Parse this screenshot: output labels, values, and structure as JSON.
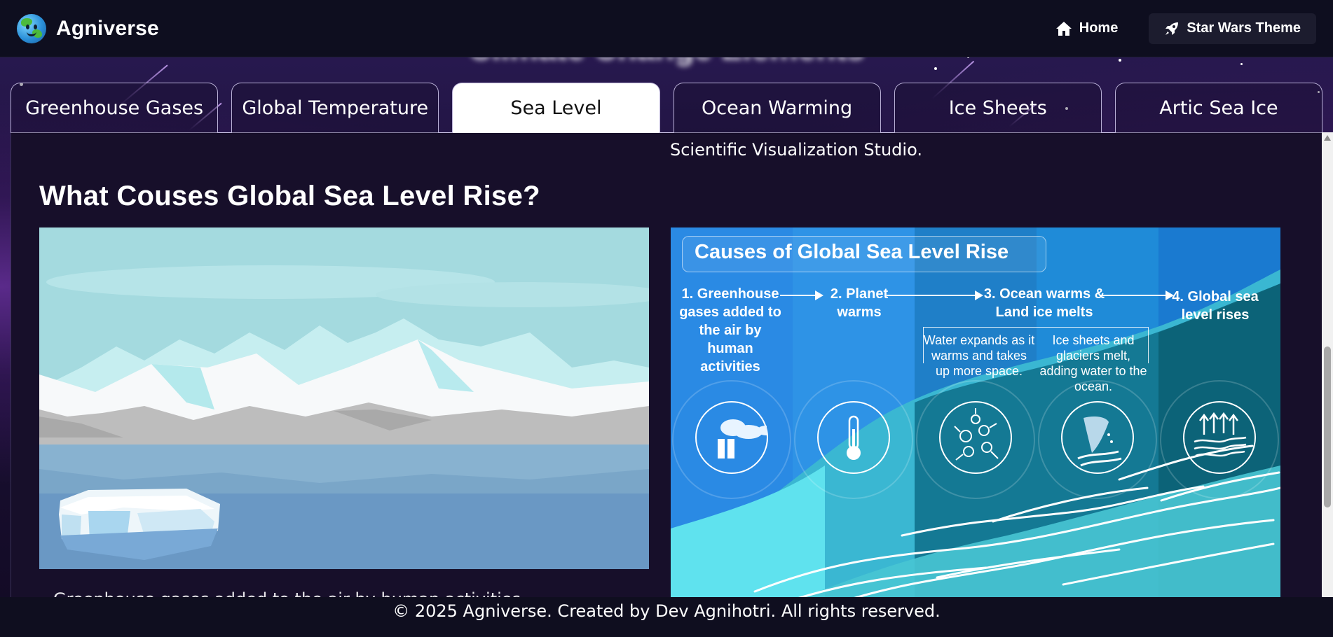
{
  "header": {
    "brand": "Agniverse",
    "nav": [
      {
        "label": "Home",
        "icon": "home-icon"
      },
      {
        "label": "Star Wars Theme",
        "icon": "rocket-icon"
      }
    ]
  },
  "page": {
    "title": "Climate Change Elements"
  },
  "tabs": [
    {
      "label": "Greenhouse Gases",
      "active": false
    },
    {
      "label": "Global Temperature",
      "active": false
    },
    {
      "label": "Sea Level",
      "active": true
    },
    {
      "label": "Ocean Warming",
      "active": false
    },
    {
      "label": "Ice Sheets",
      "active": false
    },
    {
      "label": "Artic Sea Ice",
      "active": false
    }
  ],
  "content": {
    "credit": "Scientific Visualization Studio.",
    "section_title": "What Couses Global Sea Level Rise?",
    "cut_text": "Greenhouse gases added to the air by human activities",
    "infographic": {
      "title": "Causes of Global Sea Level Rise",
      "steps": [
        "1. Greenhouse gases added to the air by human activities",
        "2. Planet warms",
        "3. Ocean warms & Land ice melts",
        "4. Global sea level rises"
      ],
      "substeps": [
        "Water expands as it warms and takes up more space.",
        "Ice sheets and glaciers melt, adding water to the ocean."
      ]
    }
  },
  "footer": {
    "text": "© 2025 Agniverse. Created by Dev Agnihotri. All rights reserved."
  },
  "colors": {
    "navbar": "#0e0e1f",
    "panel": "#170f2a",
    "active_tab": "#ffffff",
    "infographic_blue": "#1e8be0",
    "infographic_teal": "#0b7a8c"
  }
}
